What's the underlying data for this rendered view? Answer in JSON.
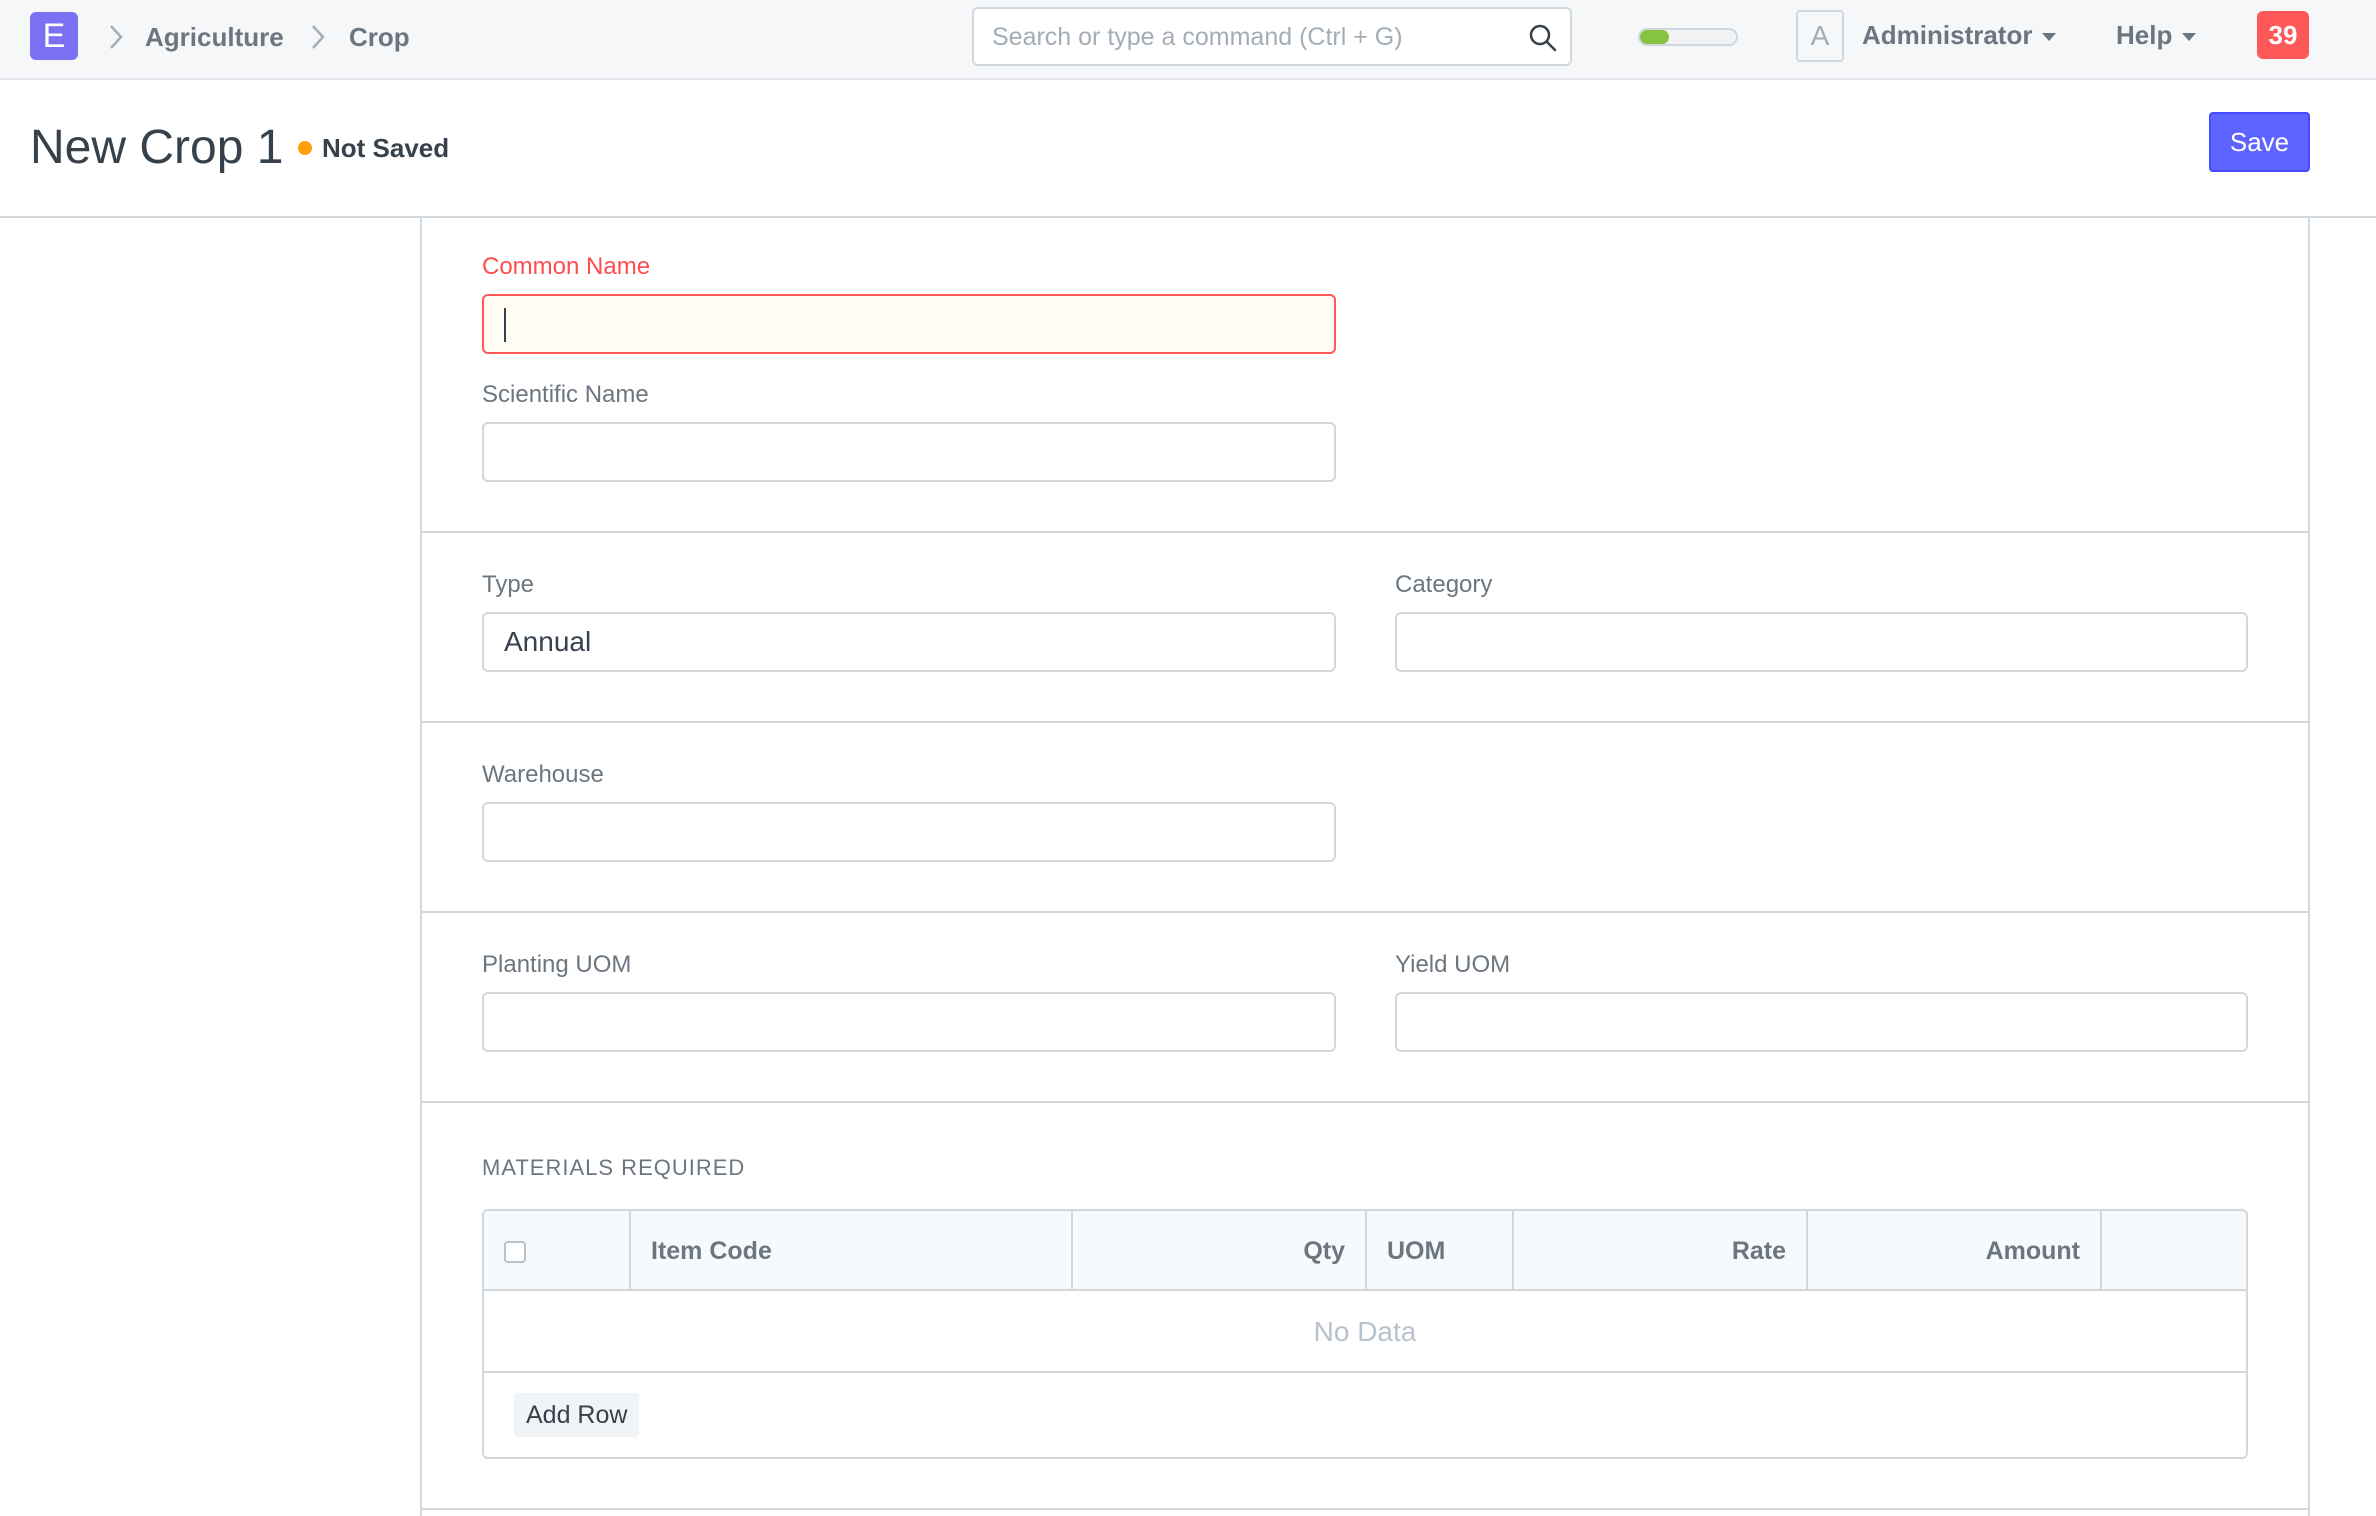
{
  "navbar": {
    "logo_letter": "E",
    "breadcrumbs": [
      "Agriculture",
      "Crop"
    ],
    "search_placeholder": "Search or type a command (Ctrl + G)",
    "progress_fraction": 0.3,
    "avatar_letter": "A",
    "user_menu": "Administrator",
    "help_menu": "Help",
    "notification_count": "39"
  },
  "page": {
    "title": "New Crop 1",
    "status": "Not Saved",
    "save_label": "Save"
  },
  "form": {
    "common_name": {
      "label": "Common Name",
      "value": ""
    },
    "scientific_name": {
      "label": "Scientific Name",
      "value": ""
    },
    "type": {
      "label": "Type",
      "value": "Annual"
    },
    "category": {
      "label": "Category",
      "value": ""
    },
    "warehouse": {
      "label": "Warehouse",
      "value": ""
    },
    "planting_uom": {
      "label": "Planting UOM",
      "value": ""
    },
    "yield_uom": {
      "label": "Yield UOM",
      "value": ""
    },
    "materials": {
      "heading": "MATERIALS REQUIRED",
      "columns": [
        "Item Code",
        "Qty",
        "UOM",
        "Rate",
        "Amount"
      ],
      "empty_text": "No Data",
      "add_row_label": "Add Row"
    }
  },
  "colors": {
    "primary": "#5e64ff",
    "logo": "#7b6ff2",
    "error": "#ff5858",
    "indicator_orange": "#ffa00a",
    "notification_red": "#ff5858",
    "progress_green": "#86c341"
  },
  "icons": [
    "chevron-right-icon",
    "search-icon",
    "caret-down-icon",
    "checkbox-icon"
  ]
}
